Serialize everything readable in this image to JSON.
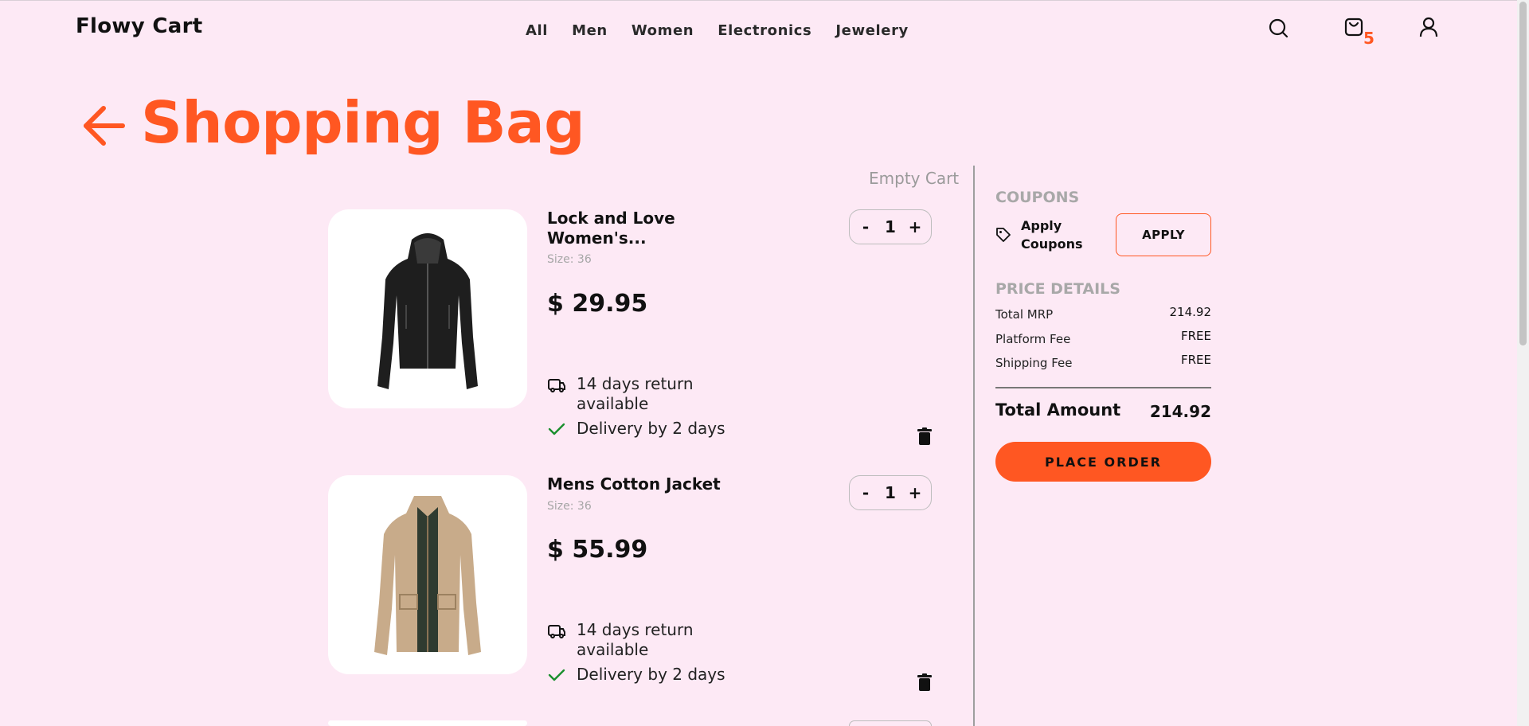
{
  "header": {
    "logo": "Flowy Cart",
    "nav": [
      "All",
      "Men",
      "Women",
      "Electronics",
      "Jewelery"
    ],
    "cart_count": "5",
    "icons": [
      "search-icon",
      "cart-icon",
      "user-icon"
    ]
  },
  "page": {
    "title": "Shopping Bag",
    "empty_cart_label": "Empty Cart"
  },
  "items": [
    {
      "name": "Lock and Love Women's...",
      "size": "Size: 36",
      "price": "$ 29.95",
      "quantity": "1",
      "return_text": "14 days return available",
      "delivery_text": "Delivery by 2 days",
      "image": "black-jacket"
    },
    {
      "name": "Mens Cotton Jacket",
      "size": "Size: 36",
      "price": "$ 55.99",
      "quantity": "1",
      "return_text": "14 days return available",
      "delivery_text": "Delivery by 2 days",
      "image": "khaki-jacket"
    }
  ],
  "quantity_controls": {
    "minus": "-",
    "plus": "+"
  },
  "sidebar": {
    "coupons_heading": "COUPONS",
    "apply_coupons_label": "Apply Coupons",
    "apply_button": "APPLY",
    "price_details_heading": "PRICE DETAILS",
    "rows": [
      {
        "label": "Total MRP",
        "value": "214.92"
      },
      {
        "label": "Platform Fee",
        "value": "FREE"
      },
      {
        "label": "Shipping Fee",
        "value": "FREE"
      }
    ],
    "total_label": "Total Amount",
    "total_value": "214.92",
    "place_order": "PLACE ORDER"
  },
  "colors": {
    "background": "#fde9f5",
    "accent": "#ff5722",
    "check": "#1a8f2e"
  }
}
